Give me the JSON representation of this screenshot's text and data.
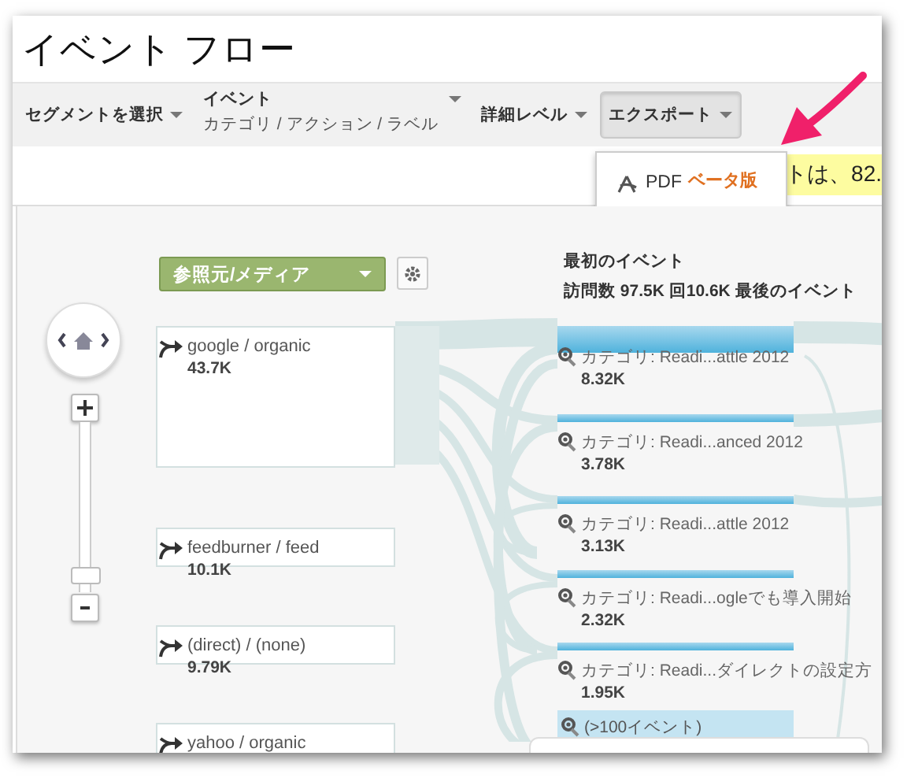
{
  "title": "イベント フロー",
  "toolbar": [
    {
      "kind": "menu",
      "label": "セグメントを選択",
      "expanded": false
    },
    {
      "kind": "two-line",
      "label": "イベント",
      "sublabel": "カテゴリ / アクション / ラベル",
      "expanded": false
    },
    {
      "kind": "menu",
      "label": "詳細レベル",
      "expanded": false
    },
    {
      "kind": "menu",
      "label": "エクスポート",
      "expanded": true
    }
  ],
  "export_menu": {
    "items": [
      {
        "label": "PDF",
        "badge": "ベータ版"
      }
    ]
  },
  "notice": {
    "text": "トは、82."
  },
  "flow": {
    "dimension_select": "参照元/メディア",
    "zoom": {
      "level": 0.05
    },
    "sources": [
      {
        "name": "google / organic",
        "value": "43.7K"
      },
      {
        "name": "feedburner / feed",
        "value": "10.1K"
      },
      {
        "name": "(direct) / (none)",
        "value": "9.79K"
      },
      {
        "name": "yahoo / organic"
      }
    ],
    "events_header": {
      "title": "最初のイベント",
      "summary": "訪問数 97.5K 回10.6K 最後のイベント"
    },
    "events": [
      {
        "label": "カテゴリ: Readi...attle 2012",
        "value": "8.32K"
      },
      {
        "label": "カテゴリ: Readi...anced 2012",
        "value": "3.78K"
      },
      {
        "label": "カテゴリ: Readi...attle 2012",
        "value": "3.13K"
      },
      {
        "label": "カテゴリ: Readi...ogleでも導入開始",
        "value": "2.32K"
      },
      {
        "label": "カテゴリ: Readi...ダイレクトの設定方",
        "value": "1.95K"
      }
    ],
    "more": "(>100イベント)"
  }
}
